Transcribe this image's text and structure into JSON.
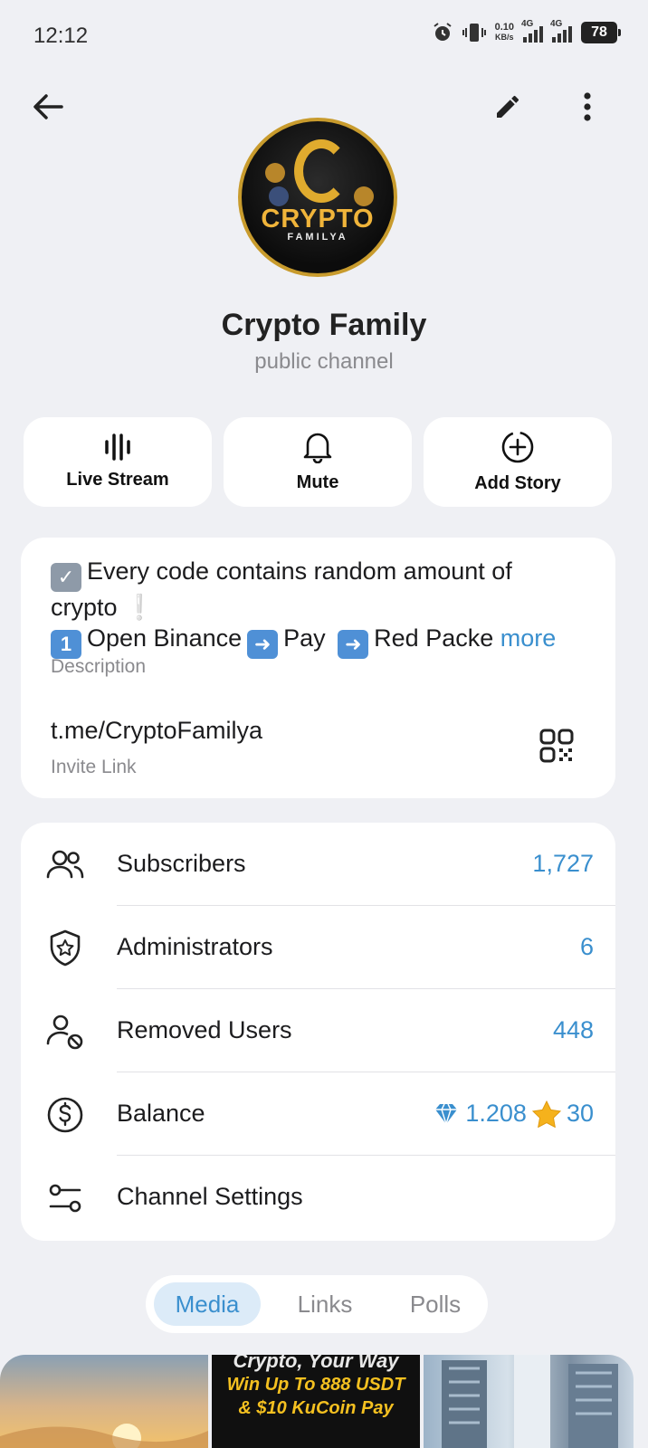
{
  "status_bar": {
    "time": "12:12",
    "net_speed_value": "0.10",
    "net_speed_unit": "KB/s",
    "signal1_label": "4G",
    "signal2_label": "4G",
    "battery": "78"
  },
  "channel": {
    "avatar_title": "CRYPTO",
    "avatar_subtitle": "FAMILYA",
    "name": "Crypto Family",
    "type": "public channel"
  },
  "actions": [
    {
      "label": "Live Stream",
      "icon": "live-stream-icon"
    },
    {
      "label": "Mute",
      "icon": "bell-icon"
    },
    {
      "label": "Add Story",
      "icon": "add-story-icon"
    }
  ],
  "info": {
    "description_line1": "Every code contains random amount of",
    "description_line2": "crypto",
    "description_line3_a": "Open Binance",
    "description_line3_b": "Pay",
    "description_line3_c": "Red Packe",
    "description_emoji_num": "1",
    "more_label": "more",
    "description_label": "Description",
    "invite_link": "t.me/CryptoFamilya",
    "invite_label": "Invite Link"
  },
  "stats": {
    "subscribers_label": "Subscribers",
    "subscribers_value": "1,727",
    "administrators_label": "Administrators",
    "administrators_value": "6",
    "removed_label": "Removed Users",
    "removed_value": "448",
    "balance_label": "Balance",
    "balance_ton": "1.208",
    "balance_stars": "30",
    "settings_label": "Channel Settings"
  },
  "tabs": {
    "media": "Media",
    "links": "Links",
    "polls": "Polls",
    "active": "Media"
  },
  "media": {
    "ad_line1": "Crypto, Your Way",
    "ad_line2": "Win Up To 888 USDT",
    "ad_line3": "& $10 KuCoin Pay"
  },
  "colors": {
    "accent": "#3a8fce",
    "background": "#eff0f4",
    "card": "#ffffff"
  }
}
